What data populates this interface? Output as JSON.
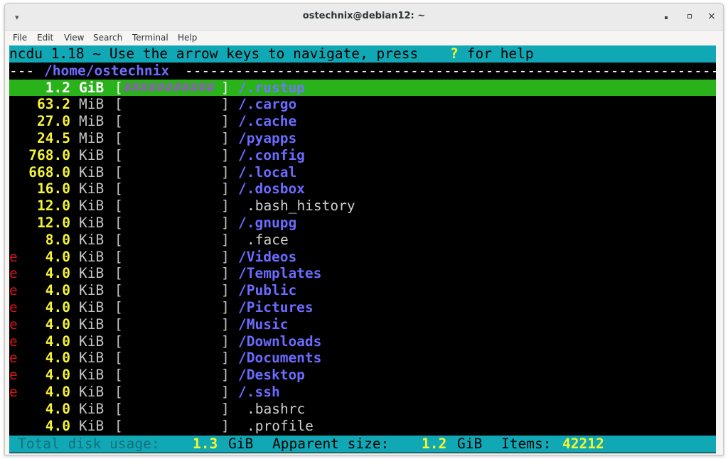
{
  "window": {
    "title": "ostechnix@debian12: ~",
    "menu_icon": "▾",
    "close_glyph": "×"
  },
  "menubar": {
    "items": [
      "File",
      "Edit",
      "View",
      "Search",
      "Terminal",
      "Help"
    ]
  },
  "ncdu": {
    "header_prefix": "ncdu 1.18 ~ Use the arrow keys to navigate, press ",
    "help_key": "?",
    "header_suffix": " for help",
    "path_prefix": "---",
    "path": "/home/ostechnix",
    "path_rule": "-----------------------------------------------------------------------",
    "selected_graph": "###########",
    "entries": [
      {
        "flag": "",
        "size": "1.2",
        "unit": "GiB",
        "name": "/.rustup",
        "type": "dir",
        "selected": true
      },
      {
        "flag": "",
        "size": "63.2",
        "unit": "MiB",
        "name": "/.cargo",
        "type": "dir",
        "selected": false
      },
      {
        "flag": "",
        "size": "27.0",
        "unit": "MiB",
        "name": "/.cache",
        "type": "dir",
        "selected": false
      },
      {
        "flag": "",
        "size": "24.5",
        "unit": "MiB",
        "name": "/pyapps",
        "type": "dir",
        "selected": false
      },
      {
        "flag": "",
        "size": "768.0",
        "unit": "KiB",
        "name": "/.config",
        "type": "dir",
        "selected": false
      },
      {
        "flag": "",
        "size": "668.0",
        "unit": "KiB",
        "name": "/.local",
        "type": "dir",
        "selected": false
      },
      {
        "flag": "",
        "size": "16.0",
        "unit": "KiB",
        "name": "/.dosbox",
        "type": "dir",
        "selected": false
      },
      {
        "flag": "",
        "size": "12.0",
        "unit": "KiB",
        "name": ".bash_history",
        "type": "file",
        "selected": false
      },
      {
        "flag": "",
        "size": "12.0",
        "unit": "KiB",
        "name": "/.gnupg",
        "type": "dir",
        "selected": false
      },
      {
        "flag": "",
        "size": "8.0",
        "unit": "KiB",
        "name": ".face",
        "type": "file",
        "selected": false
      },
      {
        "flag": "e",
        "size": "4.0",
        "unit": "KiB",
        "name": "/Videos",
        "type": "dir",
        "selected": false
      },
      {
        "flag": "e",
        "size": "4.0",
        "unit": "KiB",
        "name": "/Templates",
        "type": "dir",
        "selected": false
      },
      {
        "flag": "e",
        "size": "4.0",
        "unit": "KiB",
        "name": "/Public",
        "type": "dir",
        "selected": false
      },
      {
        "flag": "e",
        "size": "4.0",
        "unit": "KiB",
        "name": "/Pictures",
        "type": "dir",
        "selected": false
      },
      {
        "flag": "e",
        "size": "4.0",
        "unit": "KiB",
        "name": "/Music",
        "type": "dir",
        "selected": false
      },
      {
        "flag": "e",
        "size": "4.0",
        "unit": "KiB",
        "name": "/Downloads",
        "type": "dir",
        "selected": false
      },
      {
        "flag": "e",
        "size": "4.0",
        "unit": "KiB",
        "name": "/Documents",
        "type": "dir",
        "selected": false
      },
      {
        "flag": "e",
        "size": "4.0",
        "unit": "KiB",
        "name": "/Desktop",
        "type": "dir",
        "selected": false
      },
      {
        "flag": "e",
        "size": "4.0",
        "unit": "KiB",
        "name": "/.ssh",
        "type": "dir",
        "selected": false
      },
      {
        "flag": "",
        "size": "4.0",
        "unit": "KiB",
        "name": ".bashrc",
        "type": "file",
        "selected": false
      },
      {
        "flag": "",
        "size": "4.0",
        "unit": "KiB",
        "name": ".profile",
        "type": "file",
        "selected": false
      }
    ],
    "footer": {
      "total_label": "Total disk usage:",
      "total_value": "1.3",
      "total_unit": "GiB",
      "apparent_label": "Apparent size:",
      "apparent_value": "1.2",
      "apparent_unit": "GiB",
      "items_label": "Items:",
      "items_value": "42212"
    }
  }
}
